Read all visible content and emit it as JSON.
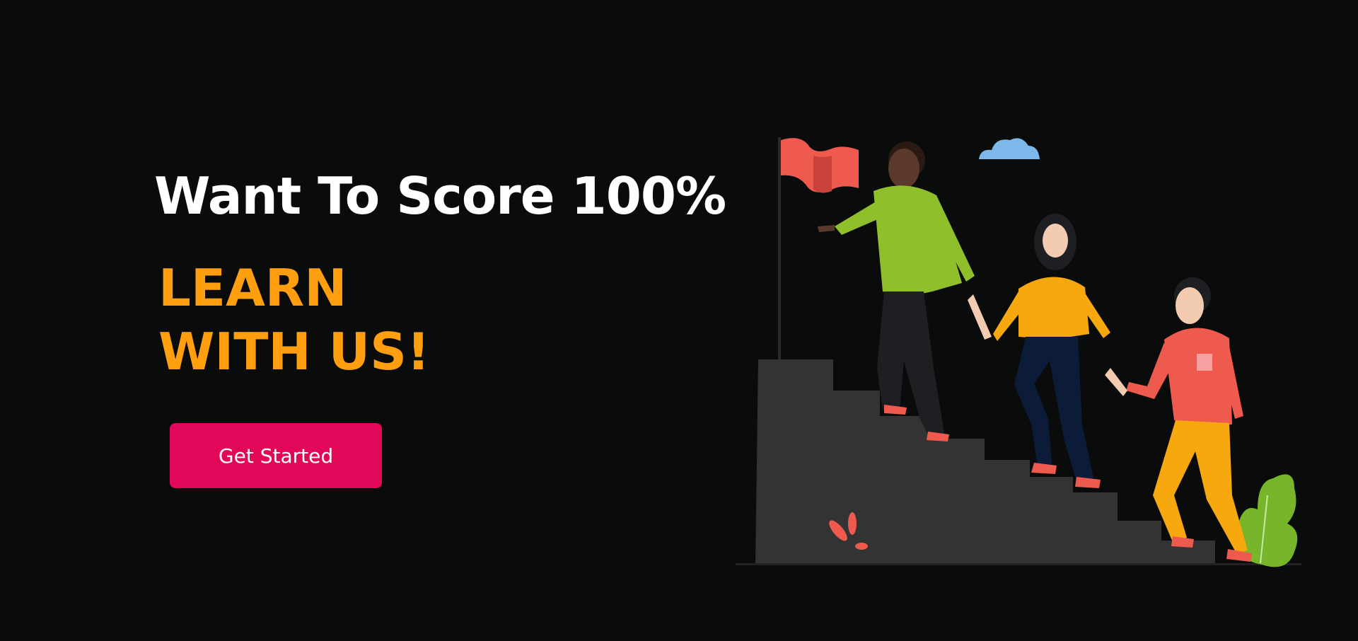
{
  "hero": {
    "headline": "Want To Score 100%",
    "tagline_line1": "LEARN",
    "tagline_line2": "WITH US!",
    "cta_label": "Get Started"
  },
  "colors": {
    "background": "#0a0b0b",
    "headline": "#ffffff",
    "tagline": "#ff9f0f",
    "cta": "#e3075a",
    "stairs": "#333333",
    "flag": "#ef5a4f",
    "cloud": "#7cb9ea",
    "plant": "#77b52b"
  },
  "illustration": {
    "subject": "three people climbing stairs holding hands toward a flag",
    "icons": [
      "flag-icon",
      "cloud-icon",
      "plant-icon",
      "leaves-icon"
    ]
  }
}
